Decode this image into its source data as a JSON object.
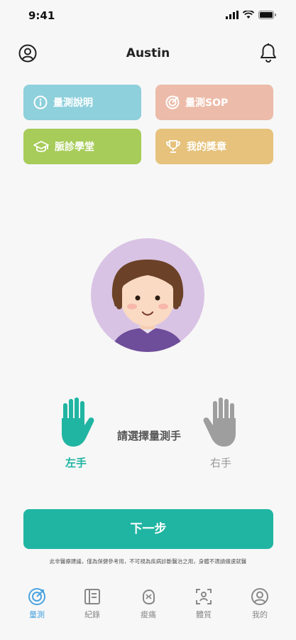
{
  "status": {
    "time": "9:41"
  },
  "header": {
    "title": "Austin"
  },
  "tiles": [
    {
      "label": "量測說明",
      "icon": "info-icon",
      "color": "#8ed0db"
    },
    {
      "label": "量測SOP",
      "icon": "target-icon",
      "color": "#ecbba9"
    },
    {
      "label": "脈診學堂",
      "icon": "graduation-cap-icon",
      "color": "#a7cc59"
    },
    {
      "label": "我的獎章",
      "icon": "trophy-icon",
      "color": "#e6c27c"
    }
  ],
  "hand_select": {
    "prompt": "請選擇量測手",
    "left_label": "左手",
    "right_label": "右手",
    "selected": "left"
  },
  "next_button": "下一步",
  "disclaimer": "此非醫療建議，僅為保健參考用，不可視為疾病診斷醫治之用，身體不適請儘速就醫",
  "tabs": [
    {
      "label": "量測",
      "icon": "target-icon",
      "active": true
    },
    {
      "label": "紀錄",
      "icon": "record-icon",
      "active": false
    },
    {
      "label": "痠痛",
      "icon": "pain-icon",
      "active": false
    },
    {
      "label": "體質",
      "icon": "body-scan-icon",
      "active": false
    },
    {
      "label": "我的",
      "icon": "profile-icon",
      "active": false
    }
  ],
  "colors": {
    "accent": "#20b5a2",
    "tab_active": "#4aa3e0",
    "inactive": "#999999"
  }
}
